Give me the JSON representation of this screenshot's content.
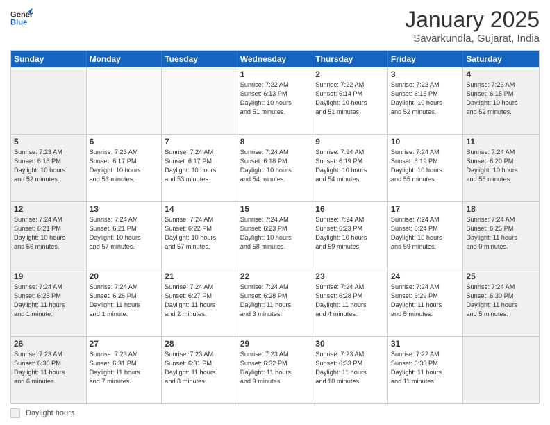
{
  "logo": {
    "line1": "General",
    "line2": "Blue"
  },
  "title": "January 2025",
  "subtitle": "Savarkundla, Gujarat, India",
  "days_of_week": [
    "Sunday",
    "Monday",
    "Tuesday",
    "Wednesday",
    "Thursday",
    "Friday",
    "Saturday"
  ],
  "weeks": [
    [
      {
        "day": "",
        "info": "",
        "empty": true
      },
      {
        "day": "",
        "info": "",
        "empty": true
      },
      {
        "day": "",
        "info": "",
        "empty": true
      },
      {
        "day": "1",
        "info": "Sunrise: 7:22 AM\nSunset: 6:13 PM\nDaylight: 10 hours\nand 51 minutes."
      },
      {
        "day": "2",
        "info": "Sunrise: 7:22 AM\nSunset: 6:14 PM\nDaylight: 10 hours\nand 51 minutes."
      },
      {
        "day": "3",
        "info": "Sunrise: 7:23 AM\nSunset: 6:15 PM\nDaylight: 10 hours\nand 52 minutes."
      },
      {
        "day": "4",
        "info": "Sunrise: 7:23 AM\nSunset: 6:15 PM\nDaylight: 10 hours\nand 52 minutes."
      }
    ],
    [
      {
        "day": "5",
        "info": "Sunrise: 7:23 AM\nSunset: 6:16 PM\nDaylight: 10 hours\nand 52 minutes."
      },
      {
        "day": "6",
        "info": "Sunrise: 7:23 AM\nSunset: 6:17 PM\nDaylight: 10 hours\nand 53 minutes."
      },
      {
        "day": "7",
        "info": "Sunrise: 7:24 AM\nSunset: 6:17 PM\nDaylight: 10 hours\nand 53 minutes."
      },
      {
        "day": "8",
        "info": "Sunrise: 7:24 AM\nSunset: 6:18 PM\nDaylight: 10 hours\nand 54 minutes."
      },
      {
        "day": "9",
        "info": "Sunrise: 7:24 AM\nSunset: 6:19 PM\nDaylight: 10 hours\nand 54 minutes."
      },
      {
        "day": "10",
        "info": "Sunrise: 7:24 AM\nSunset: 6:19 PM\nDaylight: 10 hours\nand 55 minutes."
      },
      {
        "day": "11",
        "info": "Sunrise: 7:24 AM\nSunset: 6:20 PM\nDaylight: 10 hours\nand 55 minutes."
      }
    ],
    [
      {
        "day": "12",
        "info": "Sunrise: 7:24 AM\nSunset: 6:21 PM\nDaylight: 10 hours\nand 56 minutes."
      },
      {
        "day": "13",
        "info": "Sunrise: 7:24 AM\nSunset: 6:21 PM\nDaylight: 10 hours\nand 57 minutes."
      },
      {
        "day": "14",
        "info": "Sunrise: 7:24 AM\nSunset: 6:22 PM\nDaylight: 10 hours\nand 57 minutes."
      },
      {
        "day": "15",
        "info": "Sunrise: 7:24 AM\nSunset: 6:23 PM\nDaylight: 10 hours\nand 58 minutes."
      },
      {
        "day": "16",
        "info": "Sunrise: 7:24 AM\nSunset: 6:23 PM\nDaylight: 10 hours\nand 59 minutes."
      },
      {
        "day": "17",
        "info": "Sunrise: 7:24 AM\nSunset: 6:24 PM\nDaylight: 10 hours\nand 59 minutes."
      },
      {
        "day": "18",
        "info": "Sunrise: 7:24 AM\nSunset: 6:25 PM\nDaylight: 11 hours\nand 0 minutes."
      }
    ],
    [
      {
        "day": "19",
        "info": "Sunrise: 7:24 AM\nSunset: 6:25 PM\nDaylight: 11 hours\nand 1 minute."
      },
      {
        "day": "20",
        "info": "Sunrise: 7:24 AM\nSunset: 6:26 PM\nDaylight: 11 hours\nand 1 minute."
      },
      {
        "day": "21",
        "info": "Sunrise: 7:24 AM\nSunset: 6:27 PM\nDaylight: 11 hours\nand 2 minutes."
      },
      {
        "day": "22",
        "info": "Sunrise: 7:24 AM\nSunset: 6:28 PM\nDaylight: 11 hours\nand 3 minutes."
      },
      {
        "day": "23",
        "info": "Sunrise: 7:24 AM\nSunset: 6:28 PM\nDaylight: 11 hours\nand 4 minutes."
      },
      {
        "day": "24",
        "info": "Sunrise: 7:24 AM\nSunset: 6:29 PM\nDaylight: 11 hours\nand 5 minutes."
      },
      {
        "day": "25",
        "info": "Sunrise: 7:24 AM\nSunset: 6:30 PM\nDaylight: 11 hours\nand 5 minutes."
      }
    ],
    [
      {
        "day": "26",
        "info": "Sunrise: 7:23 AM\nSunset: 6:30 PM\nDaylight: 11 hours\nand 6 minutes."
      },
      {
        "day": "27",
        "info": "Sunrise: 7:23 AM\nSunset: 6:31 PM\nDaylight: 11 hours\nand 7 minutes."
      },
      {
        "day": "28",
        "info": "Sunrise: 7:23 AM\nSunset: 6:31 PM\nDaylight: 11 hours\nand 8 minutes."
      },
      {
        "day": "29",
        "info": "Sunrise: 7:23 AM\nSunset: 6:32 PM\nDaylight: 11 hours\nand 9 minutes."
      },
      {
        "day": "30",
        "info": "Sunrise: 7:23 AM\nSunset: 6:33 PM\nDaylight: 11 hours\nand 10 minutes."
      },
      {
        "day": "31",
        "info": "Sunrise: 7:22 AM\nSunset: 6:33 PM\nDaylight: 11 hours\nand 11 minutes."
      },
      {
        "day": "",
        "info": "",
        "empty": true
      }
    ]
  ],
  "legend": {
    "box_label": "Daylight hours"
  }
}
